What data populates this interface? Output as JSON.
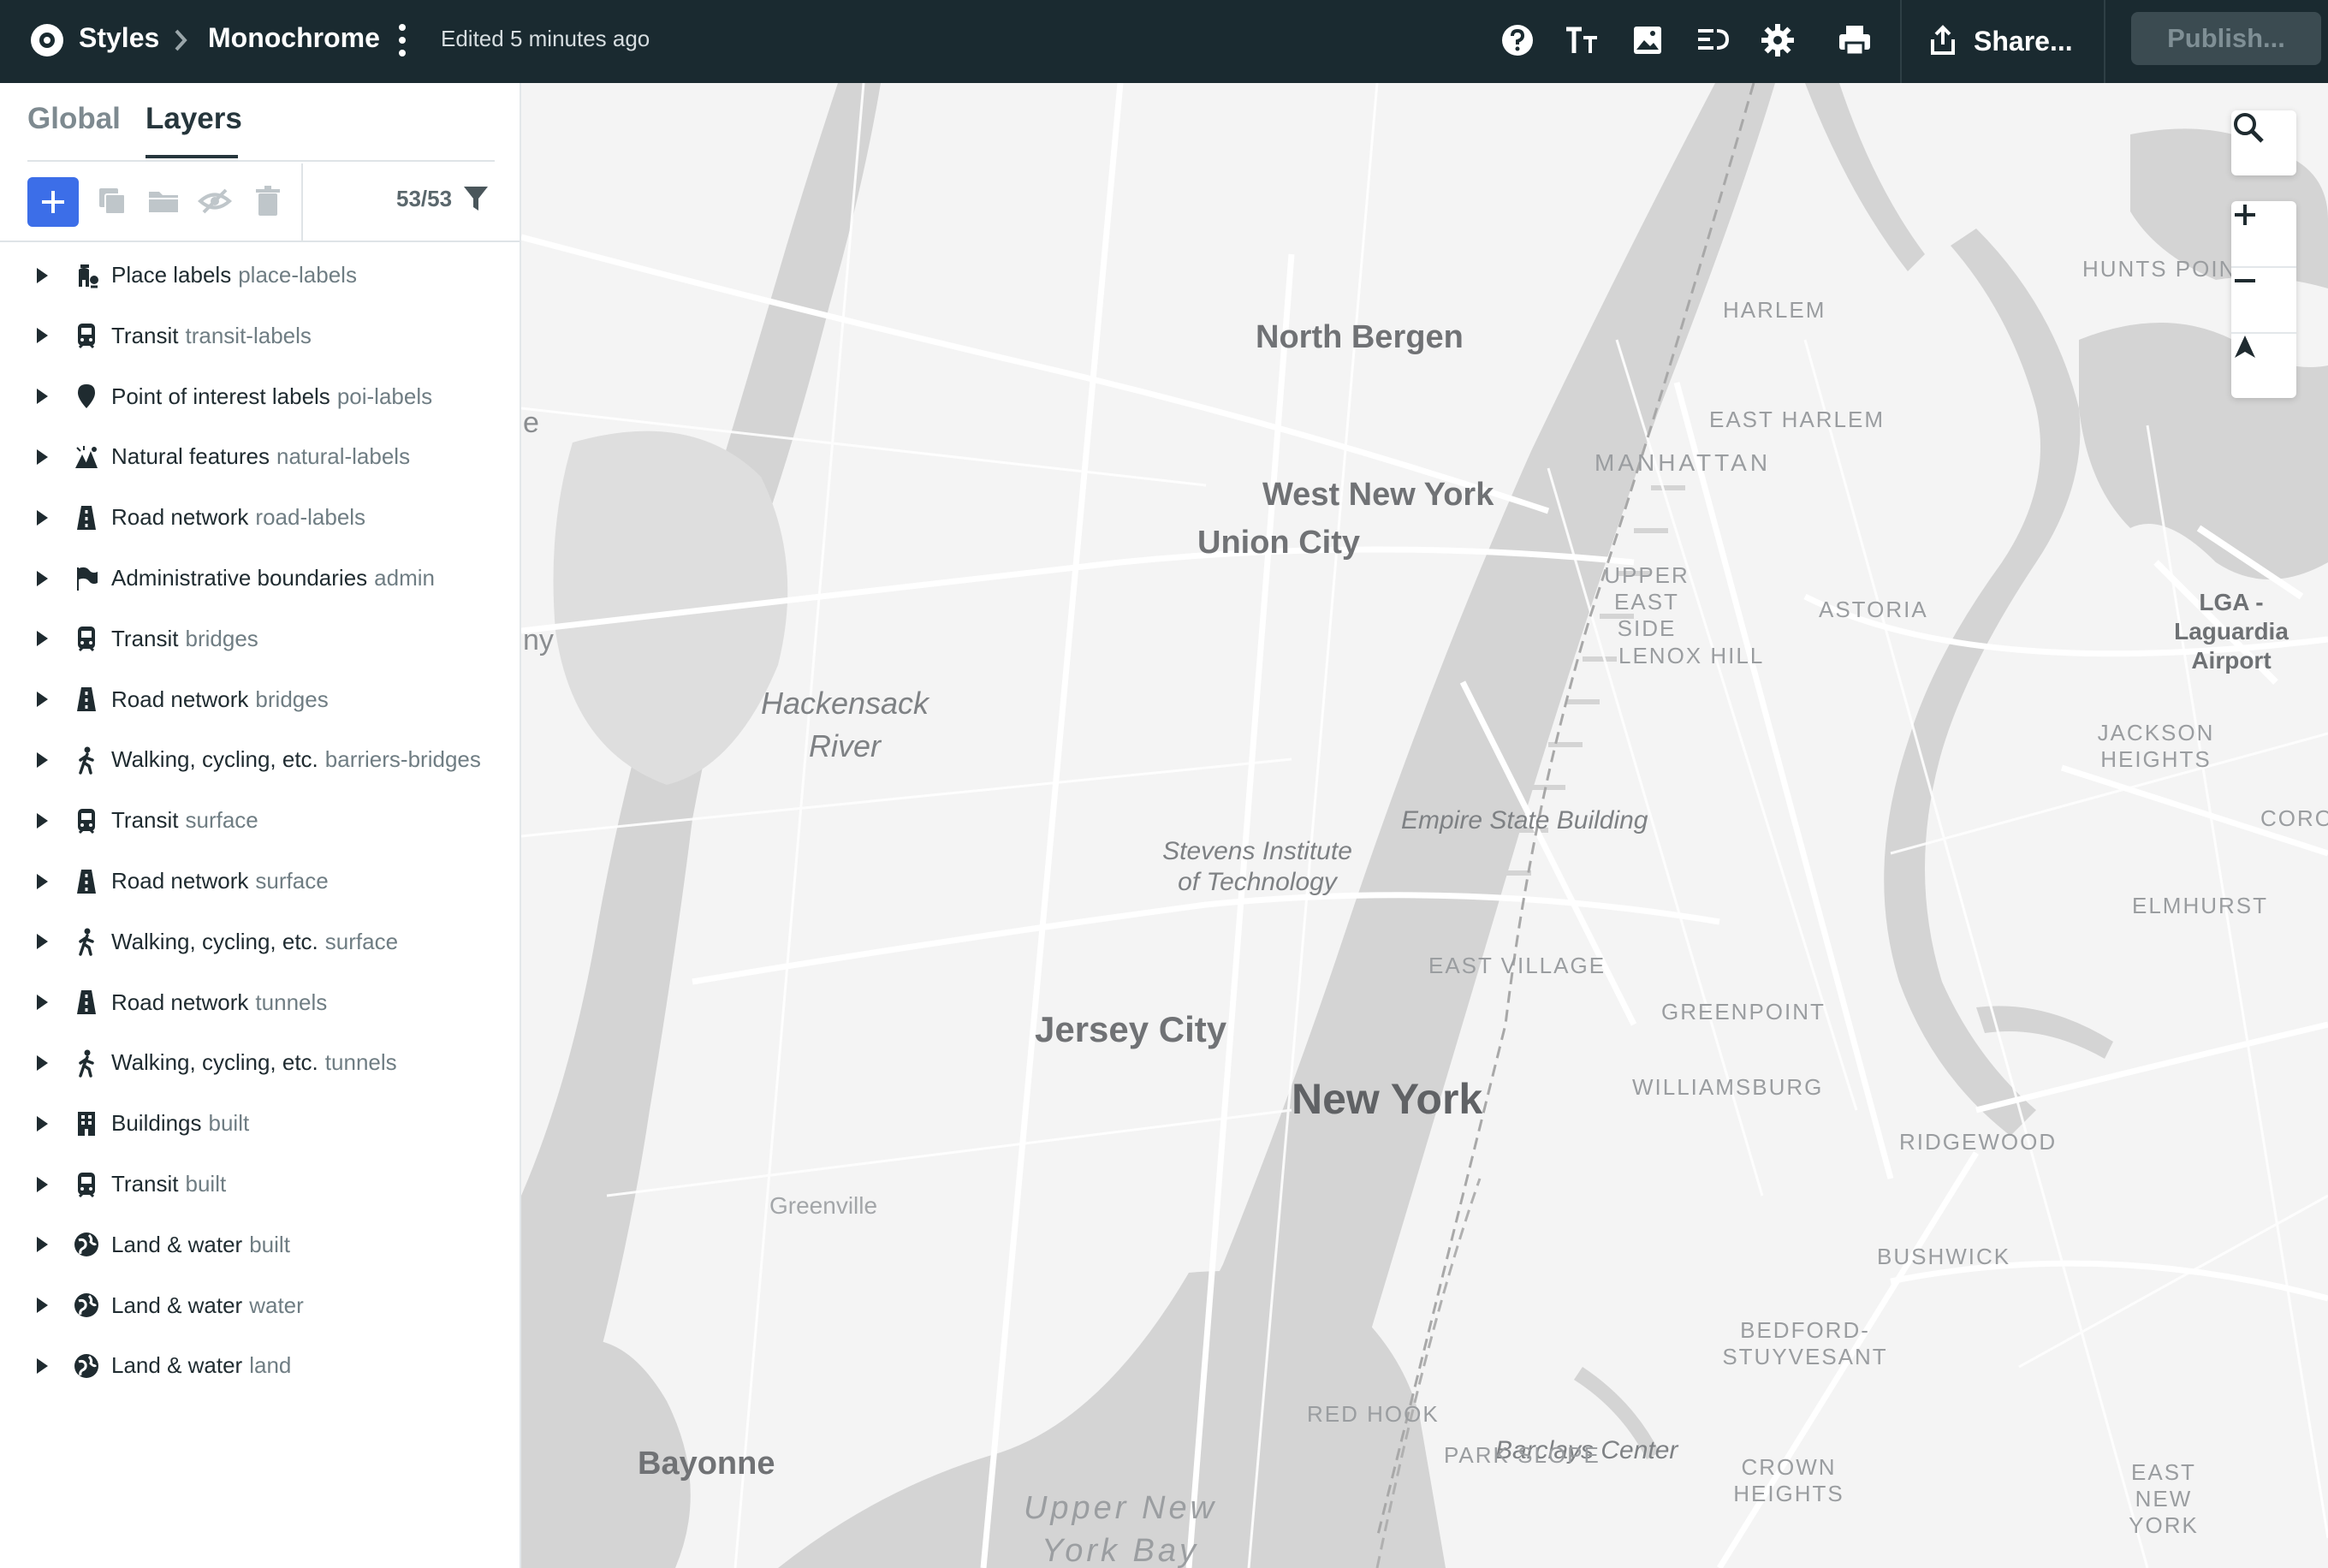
{
  "header": {
    "breadcrumb_root": "Styles",
    "style_name": "Monochrome",
    "edited_status": "Edited 5 minutes ago",
    "share_label": "Share...",
    "publish_label": "Publish...",
    "toolbar_icons": [
      "help-icon",
      "typography-icon",
      "image-icon",
      "history-icon",
      "settings-icon",
      "print-icon"
    ]
  },
  "sidebar": {
    "tabs": [
      {
        "label": "Global",
        "active": false
      },
      {
        "label": "Layers",
        "active": true
      }
    ],
    "layer_count": "53/53",
    "layers": [
      {
        "group": "Place labels",
        "sub": "place-labels",
        "icon": "place-icon"
      },
      {
        "group": "Transit",
        "sub": "transit-labels",
        "icon": "transit-icon"
      },
      {
        "group": "Point of interest labels",
        "sub": "poi-labels",
        "icon": "poi-pin-icon"
      },
      {
        "group": "Natural features",
        "sub": "natural-labels",
        "icon": "nature-icon"
      },
      {
        "group": "Road network",
        "sub": "road-labels",
        "icon": "road-icon"
      },
      {
        "group": "Administrative boundaries",
        "sub": "admin",
        "icon": "flag-icon"
      },
      {
        "group": "Transit",
        "sub": "bridges",
        "icon": "transit-icon"
      },
      {
        "group": "Road network",
        "sub": "bridges",
        "icon": "road-icon"
      },
      {
        "group": "Walking, cycling, etc.",
        "sub": "barriers-bridges",
        "icon": "walking-icon"
      },
      {
        "group": "Transit",
        "sub": "surface",
        "icon": "transit-icon"
      },
      {
        "group": "Road network",
        "sub": "surface",
        "icon": "road-icon"
      },
      {
        "group": "Walking, cycling, etc.",
        "sub": "surface",
        "icon": "walking-icon"
      },
      {
        "group": "Road network",
        "sub": "tunnels",
        "icon": "road-icon"
      },
      {
        "group": "Walking, cycling, etc.",
        "sub": "tunnels",
        "icon": "walking-icon"
      },
      {
        "group": "Buildings",
        "sub": "built",
        "icon": "building-icon"
      },
      {
        "group": "Transit",
        "sub": "built",
        "icon": "transit-icon"
      },
      {
        "group": "Land & water",
        "sub": "built",
        "icon": "globe-icon"
      },
      {
        "group": "Land & water",
        "sub": "water",
        "icon": "globe-icon"
      },
      {
        "group": "Land & water",
        "sub": "land",
        "icon": "globe-icon"
      }
    ]
  },
  "map": {
    "labels": {
      "north_bergen": "North Bergen",
      "west_new_york": "West New York",
      "union_city": "Union City",
      "hackensack_river": "Hackensack River",
      "jersey_city": "Jersey City",
      "new_york": "New York",
      "greenville": "Greenville",
      "bayonne": "Bayonne",
      "upper_new_york_bay": "Upper New York Bay",
      "stevens": "Stevens Institute of Technology",
      "empire_state": "Empire State Building",
      "barclays": "Barclays Center",
      "harlem": "HARLEM",
      "east_harlem": "EAST HARLEM",
      "manhattan": "MANHATTAN",
      "upper_east_side": "UPPER EAST SIDE",
      "lenox_hill": "LENOX HILL",
      "astoria": "ASTORIA",
      "jackson_heights": "JACKSON HEIGHTS",
      "elmhurst": "ELMHURST",
      "east_village": "EAST VILLAGE",
      "greenpoint": "GREENPOINT",
      "williamsburg": "WILLIAMSBURG",
      "ridgewood": "RIDGEWOOD",
      "bushwick": "BUSHWICK",
      "bedford_stuyvesant": "BEDFORD-STUYVESANT",
      "red_hook": "RED HOOK",
      "park_slope": "PARK SLOPE",
      "crown_heights": "CROWN HEIGHTS",
      "east_new_york": "EAST NEW YORK",
      "hunts_point": "HUNTS POINT",
      "corona": "CORO",
      "lga": "LGA - Laguardia Airport",
      "edge_e": "e",
      "edge_ny": "ny"
    }
  },
  "colors": {
    "header_bg": "#1a2a30",
    "accent": "#3c6ee8",
    "map_land": "#f4f4f4",
    "map_water": "#d4d4d4"
  }
}
